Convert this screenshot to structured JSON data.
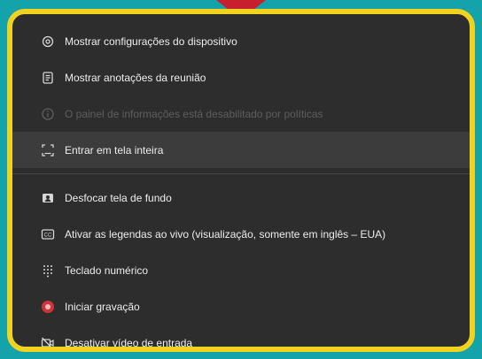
{
  "menu": {
    "items": [
      {
        "id": "device-settings",
        "label": "Mostrar configurações do dispositivo",
        "icon": "gear-icon",
        "enabled": true
      },
      {
        "id": "meeting-notes",
        "label": "Mostrar anotações da reunião",
        "icon": "notes-icon",
        "enabled": true
      },
      {
        "id": "info-panel",
        "label": "O painel de informações está desabilitado por políticas",
        "icon": "info-icon",
        "enabled": false
      },
      {
        "id": "fullscreen",
        "label": "Entrar em tela inteira",
        "icon": "fullscreen-icon",
        "enabled": true,
        "highlighted": true
      },
      {
        "id": "blur-background",
        "label": "Desfocar tela de fundo",
        "icon": "blur-background-icon",
        "enabled": true
      },
      {
        "id": "live-captions",
        "label": "Ativar as legendas ao vivo (visualização, somente em inglês – EUA)",
        "icon": "captions-icon",
        "enabled": true
      },
      {
        "id": "dialpad",
        "label": "Teclado numérico",
        "icon": "dialpad-icon",
        "enabled": true
      },
      {
        "id": "start-recording",
        "label": "Iniciar gravação",
        "icon": "record-icon",
        "enabled": true
      },
      {
        "id": "disable-incoming-video",
        "label": "Desativar vídeo de entrada",
        "icon": "video-off-icon",
        "enabled": true
      }
    ]
  },
  "colors": {
    "background": "#14a3aa",
    "frame_border": "#f0d21f",
    "menu_bg": "#2d2d2d",
    "pointer": "#c71f2d",
    "record": "#d13438"
  }
}
